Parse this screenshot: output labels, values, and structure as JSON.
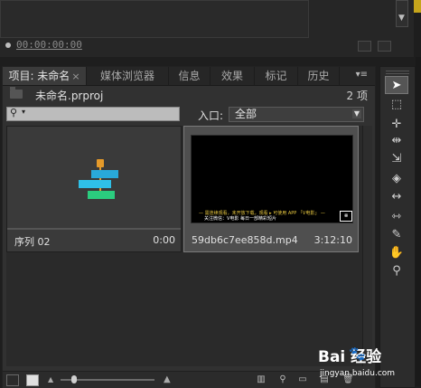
{
  "monitor": {
    "timecode": "00:00:00:00"
  },
  "project_panel": {
    "tabs": [
      {
        "label": "项目: 未命名",
        "close": "×"
      },
      {
        "label": "媒体浏览器"
      },
      {
        "label": "信息"
      },
      {
        "label": "效果"
      },
      {
        "label": "标记"
      },
      {
        "label": "历史"
      }
    ],
    "menu_glyph": "▾≡",
    "project_file": "未命名.prproj",
    "item_count": "2 项",
    "search": {
      "value": "",
      "icon": "search-icon"
    },
    "entry": {
      "label": "入口:",
      "selected": "全部"
    },
    "items": [
      {
        "name": "序列 02",
        "duration": "0:00",
        "type": "sequence"
      },
      {
        "name": "59db6c7ee858d.mp4",
        "duration": "3:12:10",
        "type": "clip",
        "subtitle_line1": "— 需连续观看，未开放下载，观看 ▸ 可使用 APP 「V电影」 —",
        "subtitle_line2": "关注微信：V电影 每日一部精彩短片",
        "badge": "⧻"
      }
    ]
  },
  "tools": [
    {
      "name": "selection-tool",
      "glyph": "➤",
      "active": true
    },
    {
      "name": "track-select-tool",
      "glyph": "⬚",
      "active": false
    },
    {
      "name": "ripple-edit-tool",
      "glyph": "✛",
      "active": false
    },
    {
      "name": "rolling-edit-tool",
      "glyph": "⇹",
      "active": false
    },
    {
      "name": "rate-stretch-tool",
      "glyph": "⇲",
      "active": false
    },
    {
      "name": "razor-tool",
      "glyph": "◈",
      "active": false
    },
    {
      "name": "slip-tool",
      "glyph": "↔",
      "active": false
    },
    {
      "name": "slide-tool",
      "glyph": "⇿",
      "active": false
    },
    {
      "name": "pen-tool",
      "glyph": "✎",
      "active": false
    },
    {
      "name": "hand-tool",
      "glyph": "✋",
      "active": false
    },
    {
      "name": "zoom-tool",
      "glyph": "⚲",
      "active": false
    }
  ],
  "watermark": {
    "brand": "Bai  经验",
    "url": "jingyan.baidu.com"
  },
  "colors": {
    "sequence_pin": "#e59a2a",
    "sequence_blue": "#29a9d9",
    "sequence_green": "#2bcc7e",
    "accent_top": "#c6a51b"
  }
}
